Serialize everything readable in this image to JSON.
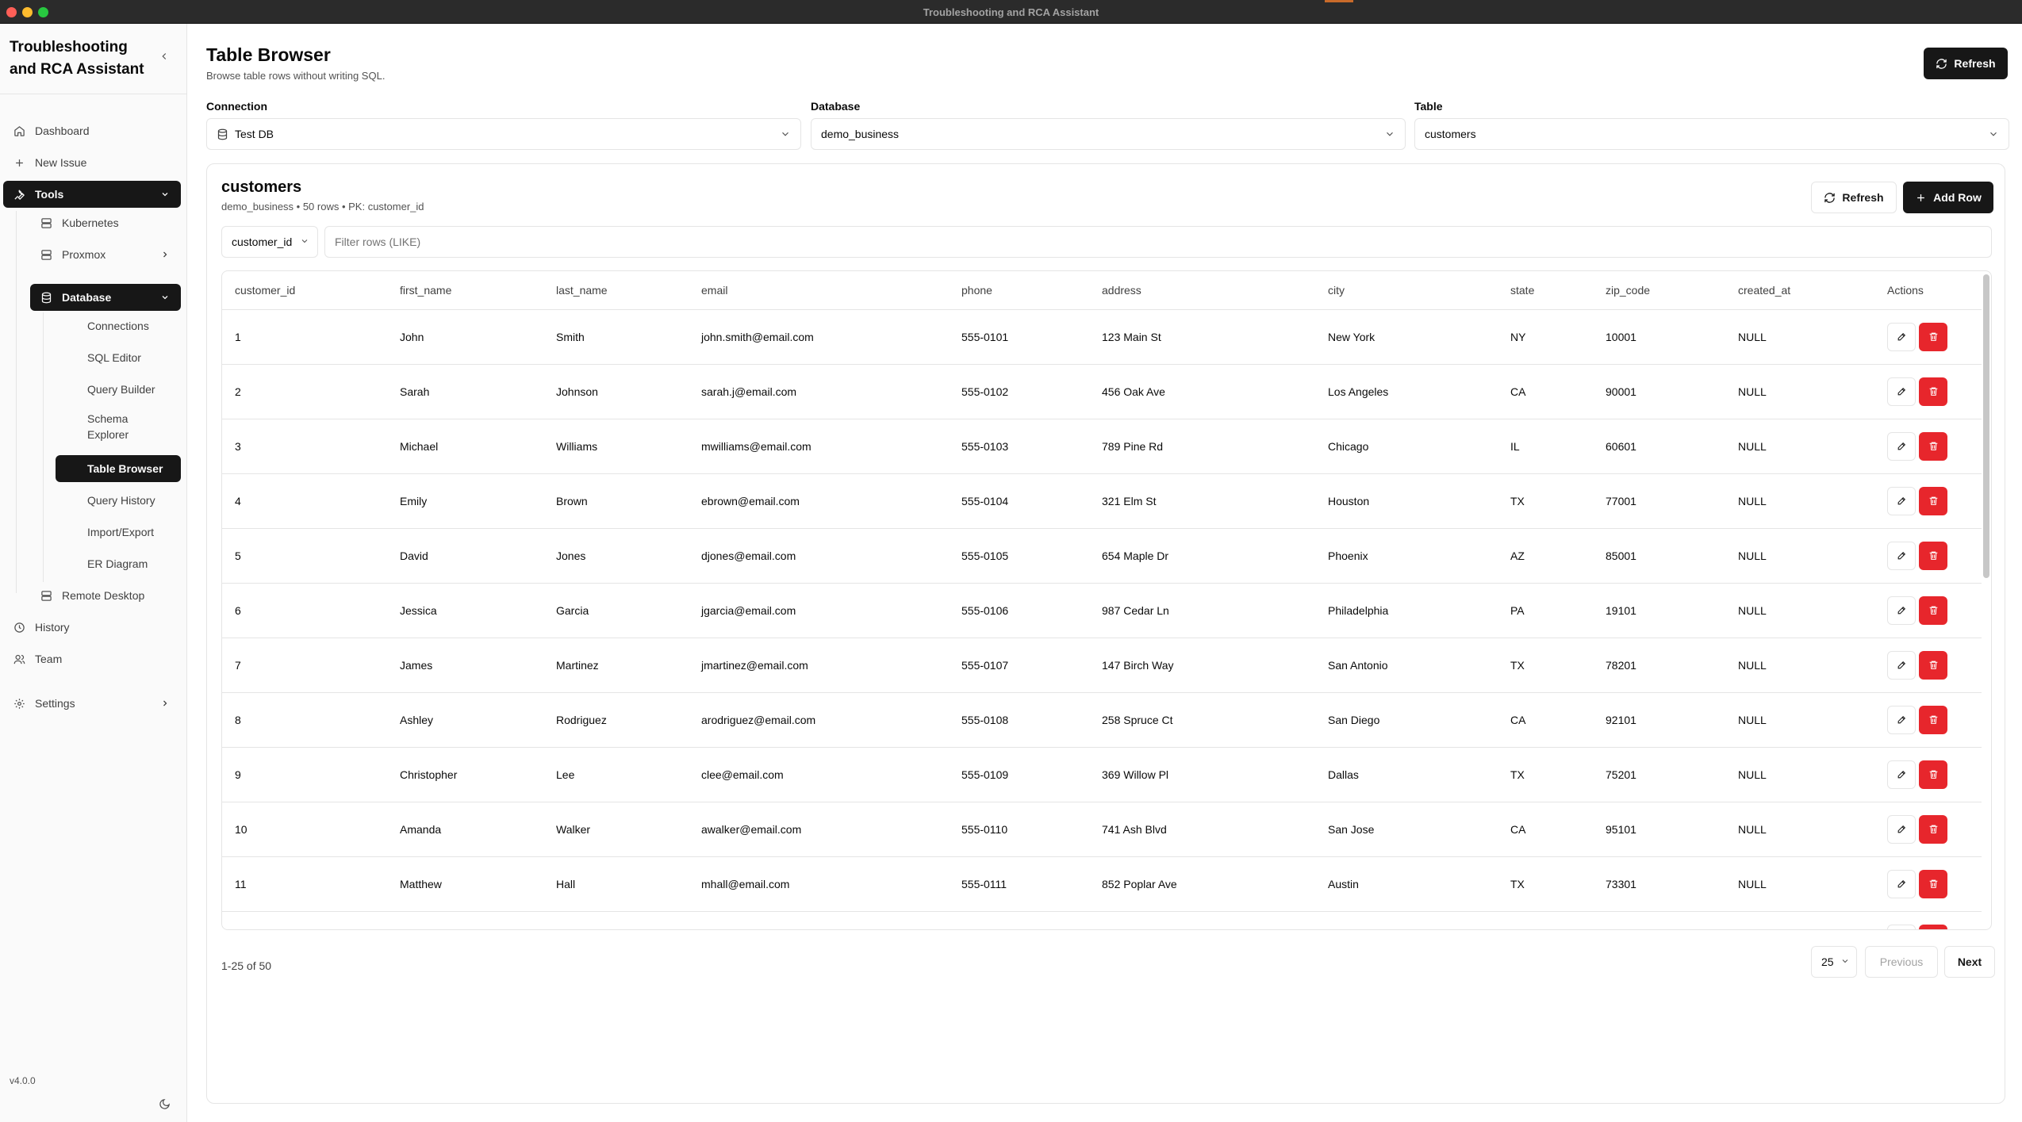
{
  "window": {
    "title": "Troubleshooting and RCA Assistant"
  },
  "sidebar": {
    "brand": "Troubleshooting and RCA Assistant",
    "items": {
      "dashboard": "Dashboard",
      "new_issue": "New Issue",
      "tools": "Tools",
      "kubernetes": "Kubernetes",
      "proxmox": "Proxmox",
      "database": "Database",
      "connections": "Connections",
      "sql_editor": "SQL Editor",
      "query_builder": "Query Builder",
      "schema_explorer": "Schema Explorer",
      "table_browser": "Table Browser",
      "query_history": "Query History",
      "import_export": "Import/Export",
      "er_diagram": "ER Diagram",
      "remote_desktop": "Remote Desktop",
      "history": "History",
      "team": "Team",
      "settings": "Settings"
    },
    "version": "v4.0.0"
  },
  "header": {
    "title": "Table Browser",
    "subtitle": "Browse table rows without writing SQL.",
    "refresh_label": "Refresh"
  },
  "filters": {
    "connection_label": "Connection",
    "connection_value": "Test DB",
    "database_label": "Database",
    "database_value": "demo_business",
    "table_label": "Table",
    "table_value": "customers"
  },
  "card": {
    "title": "customers",
    "meta": "demo_business • 50 rows • PK: customer_id",
    "refresh_label": "Refresh",
    "add_row_label": "Add Row",
    "filter_column": "customer_id",
    "filter_placeholder": "Filter rows (LIKE)"
  },
  "table": {
    "columns": [
      "customer_id",
      "first_name",
      "last_name",
      "email",
      "phone",
      "address",
      "city",
      "state",
      "zip_code",
      "created_at",
      "Actions"
    ],
    "rows": [
      [
        "1",
        "John",
        "Smith",
        "john.smith@email.com",
        "555-0101",
        "123 Main St",
        "New York",
        "NY",
        "10001",
        "NULL"
      ],
      [
        "2",
        "Sarah",
        "Johnson",
        "sarah.j@email.com",
        "555-0102",
        "456 Oak Ave",
        "Los Angeles",
        "CA",
        "90001",
        "NULL"
      ],
      [
        "3",
        "Michael",
        "Williams",
        "mwilliams@email.com",
        "555-0103",
        "789 Pine Rd",
        "Chicago",
        "IL",
        "60601",
        "NULL"
      ],
      [
        "4",
        "Emily",
        "Brown",
        "ebrown@email.com",
        "555-0104",
        "321 Elm St",
        "Houston",
        "TX",
        "77001",
        "NULL"
      ],
      [
        "5",
        "David",
        "Jones",
        "djones@email.com",
        "555-0105",
        "654 Maple Dr",
        "Phoenix",
        "AZ",
        "85001",
        "NULL"
      ],
      [
        "6",
        "Jessica",
        "Garcia",
        "jgarcia@email.com",
        "555-0106",
        "987 Cedar Ln",
        "Philadelphia",
        "PA",
        "19101",
        "NULL"
      ],
      [
        "7",
        "James",
        "Martinez",
        "jmartinez@email.com",
        "555-0107",
        "147 Birch Way",
        "San Antonio",
        "TX",
        "78201",
        "NULL"
      ],
      [
        "8",
        "Ashley",
        "Rodriguez",
        "arodriguez@email.com",
        "555-0108",
        "258 Spruce Ct",
        "San Diego",
        "CA",
        "92101",
        "NULL"
      ],
      [
        "9",
        "Christopher",
        "Lee",
        "clee@email.com",
        "555-0109",
        "369 Willow Pl",
        "Dallas",
        "TX",
        "75201",
        "NULL"
      ],
      [
        "10",
        "Amanda",
        "Walker",
        "awalker@email.com",
        "555-0110",
        "741 Ash Blvd",
        "San Jose",
        "CA",
        "95101",
        "NULL"
      ],
      [
        "11",
        "Matthew",
        "Hall",
        "mhall@email.com",
        "555-0111",
        "852 Poplar Ave",
        "Austin",
        "TX",
        "73301",
        "NULL"
      ],
      [
        "",
        "",
        "",
        "",
        "",
        "",
        "",
        "",
        "",
        ""
      ]
    ]
  },
  "pagination": {
    "range_text": "1-25 of 50",
    "page_size": "25",
    "previous_label": "Previous",
    "next_label": "Next"
  },
  "colors": {
    "primary": "#171717",
    "danger": "#e7262c",
    "border": "#e5e5e5"
  }
}
